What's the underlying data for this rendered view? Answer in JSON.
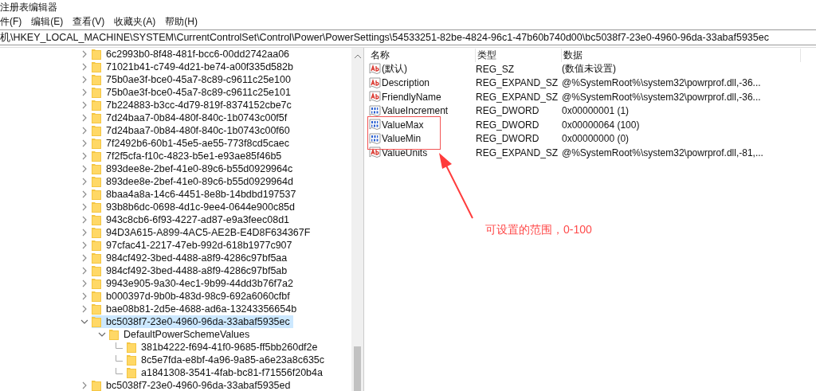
{
  "window": {
    "title": "注册表编辑器"
  },
  "menu": [
    "件(F)",
    "编辑(E)",
    "查看(V)",
    "收藏夹(A)",
    "帮助(H)"
  ],
  "address": "机\\HKEY_LOCAL_MACHINE\\SYSTEM\\CurrentControlSet\\Control\\Power\\PowerSettings\\54533251-82be-4824-96c1-47b60b740d00\\bc5038f7-23e0-4960-96da-33abaf5935ec",
  "tree": [
    {
      "name": "6c2993b0-8f48-481f-bcc6-00dd2742aa06",
      "expanded": false,
      "selected": false
    },
    {
      "name": "71021b41-c749-4d21-be74-a00f335d582b",
      "expanded": false,
      "selected": false
    },
    {
      "name": "75b0ae3f-bce0-45a7-8c89-c9611c25e100",
      "expanded": false,
      "selected": false
    },
    {
      "name": "75b0ae3f-bce0-45a7-8c89-c9611c25e101",
      "expanded": false,
      "selected": false
    },
    {
      "name": "7b224883-b3cc-4d79-819f-8374152cbe7c",
      "expanded": false,
      "selected": false
    },
    {
      "name": "7d24baa7-0b84-480f-840c-1b0743c00f5f",
      "expanded": false,
      "selected": false
    },
    {
      "name": "7d24baa7-0b84-480f-840c-1b0743c00f60",
      "expanded": false,
      "selected": false
    },
    {
      "name": "7f2492b6-60b1-45e5-ae55-773f8cd5caec",
      "expanded": false,
      "selected": false
    },
    {
      "name": "7f2f5cfa-f10c-4823-b5e1-e93ae85f46b5",
      "expanded": false,
      "selected": false
    },
    {
      "name": "893dee8e-2bef-41e0-89c6-b55d0929964c",
      "expanded": false,
      "selected": false
    },
    {
      "name": "893dee8e-2bef-41e0-89c6-b55d0929964d",
      "expanded": false,
      "selected": false
    },
    {
      "name": "8baa4a8a-14c6-4451-8e8b-14bdbd197537",
      "expanded": false,
      "selected": false
    },
    {
      "name": "93b8b6dc-0698-4d1c-9ee4-0644e900c85d",
      "expanded": false,
      "selected": false
    },
    {
      "name": "943c8cb6-6f93-4227-ad87-e9a3feec08d1",
      "expanded": false,
      "selected": false
    },
    {
      "name": "94D3A615-A899-4AC5-AE2B-E4D8F634367F",
      "expanded": false,
      "selected": false
    },
    {
      "name": "97cfac41-2217-47eb-992d-618b1977c907",
      "expanded": false,
      "selected": false
    },
    {
      "name": "984cf492-3bed-4488-a8f9-4286c97bf5aa",
      "expanded": false,
      "selected": false
    },
    {
      "name": "984cf492-3bed-4488-a8f9-4286c97bf5ab",
      "expanded": false,
      "selected": false
    },
    {
      "name": "9943e905-9a30-4ec1-9b99-44dd3b76f7a2",
      "expanded": false,
      "selected": false
    },
    {
      "name": "b000397d-9b0b-483d-98c9-692a6060cfbf",
      "expanded": false,
      "selected": false
    },
    {
      "name": "bae08b81-2d5e-4688-ad6a-13243356654b",
      "expanded": false,
      "selected": false
    },
    {
      "name": "bc5038f7-23e0-4960-96da-33abaf5935ec",
      "expanded": true,
      "selected": true,
      "children": [
        {
          "name": "DefaultPowerSchemeValues",
          "expanded": true,
          "selected": false,
          "children": [
            {
              "name": "381b4222-f694-41f0-9685-ff5bb260df2e",
              "selected": false
            },
            {
              "name": "8c5e7fda-e8bf-4a96-9a85-a6e23a8c635c",
              "selected": false
            },
            {
              "name": "a1841308-3541-4fab-bc81-f71556f20b4a",
              "selected": false
            }
          ]
        }
      ]
    },
    {
      "name": "bc5038f7-23e0-4960-96da-33abaf5935ed",
      "expanded": false,
      "selected": false
    }
  ],
  "values": {
    "columns": [
      "名称",
      "类型",
      "数据"
    ],
    "rows": [
      {
        "kind": "string",
        "name": "(默认)",
        "type": "REG_SZ",
        "data": "(数值未设置)"
      },
      {
        "kind": "string",
        "name": "Description",
        "type": "REG_EXPAND_SZ",
        "data": "@%SystemRoot%\\system32\\powrprof.dll,-36..."
      },
      {
        "kind": "string",
        "name": "FriendlyName",
        "type": "REG_EXPAND_SZ",
        "data": "@%SystemRoot%\\system32\\powrprof.dll,-36..."
      },
      {
        "kind": "dword",
        "name": "ValueIncrement",
        "type": "REG_DWORD",
        "data": "0x00000001 (1)"
      },
      {
        "kind": "dword",
        "name": "ValueMax",
        "type": "REG_DWORD",
        "data": "0x00000064 (100)"
      },
      {
        "kind": "dword",
        "name": "ValueMin",
        "type": "REG_DWORD",
        "data": "0x00000000 (0)"
      },
      {
        "kind": "string",
        "name": "ValueUnits",
        "type": "REG_EXPAND_SZ",
        "data": "@%SystemRoot%\\system32\\powrprof.dll,-81,..."
      }
    ]
  },
  "annotation": {
    "text": "可设置的范围，0-100"
  }
}
